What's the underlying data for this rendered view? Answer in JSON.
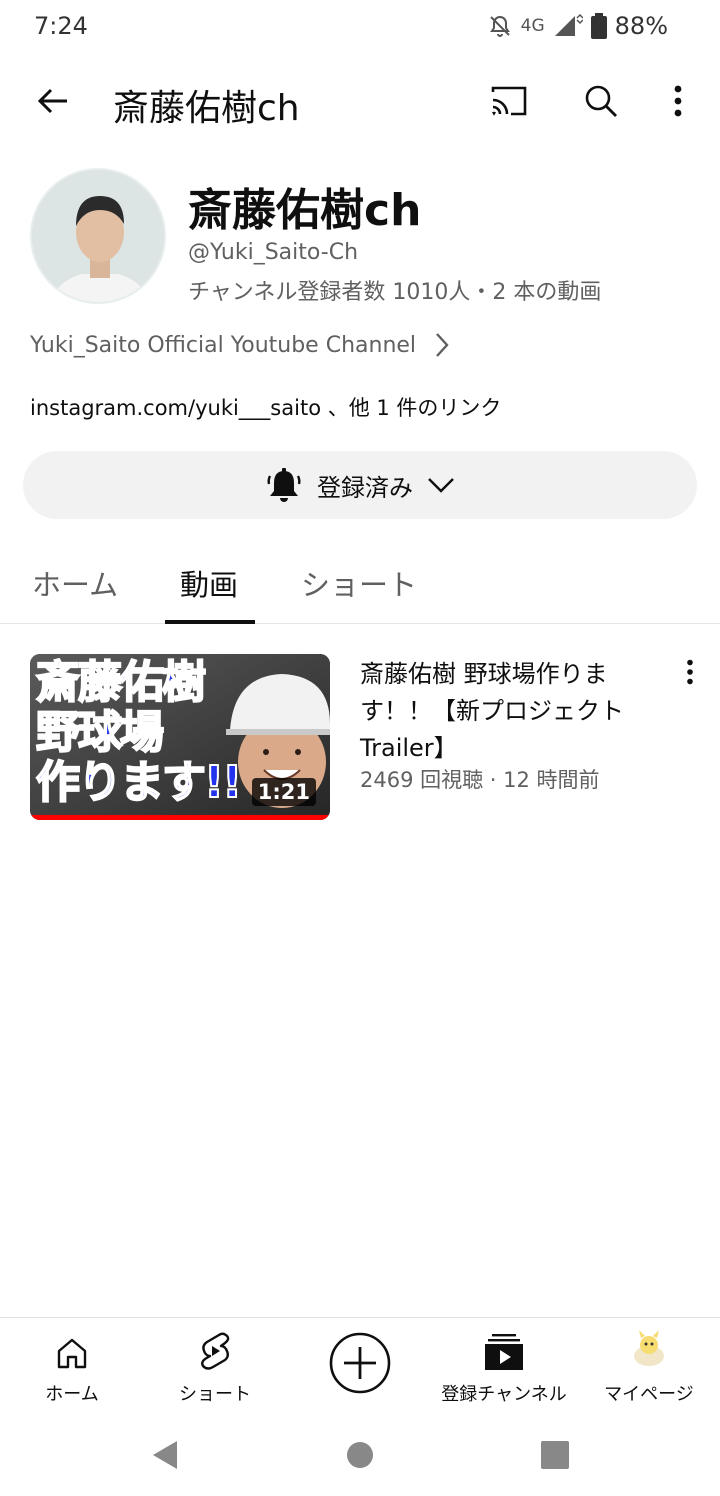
{
  "status_bar": {
    "time": "7:24",
    "network": "4G",
    "battery": "88%"
  },
  "app_bar": {
    "title": "斎藤佑樹ch"
  },
  "channel": {
    "name": "斎藤佑樹ch",
    "handle": "@Yuki_Saito-Ch",
    "stats": "チャンネル登録者数 1010人・2 本の動画",
    "description": "Yuki_Saito Official Youtube Channel",
    "link_main": "instagram.com/yuki___saito",
    "link_extra": " 、他 1 件のリンク",
    "subscribe_label": "登録済み"
  },
  "tabs": [
    {
      "label": "ホーム",
      "active": false
    },
    {
      "label": "動画",
      "active": true
    },
    {
      "label": "ショート",
      "active": false
    }
  ],
  "videos": [
    {
      "title": "斎藤佑樹  野球場作ります！！【新プロジェクト Trailer】",
      "meta": "2469 回視聴 · 12 時間前",
      "duration": "1:21",
      "thumb_text_1": "斎藤佑樹",
      "thumb_text_2": "野球場",
      "thumb_text_3": "作ります!!",
      "watched_fraction": 1.0
    }
  ],
  "bottom_nav": {
    "home": "ホーム",
    "shorts": "ショート",
    "subscriptions": "登録チャンネル",
    "mypage": "マイページ"
  },
  "colors": {
    "accent": "#ff0000",
    "text_primary": "#0f0f0f",
    "text_secondary": "#606060",
    "chip_bg": "#f2f2f2"
  }
}
